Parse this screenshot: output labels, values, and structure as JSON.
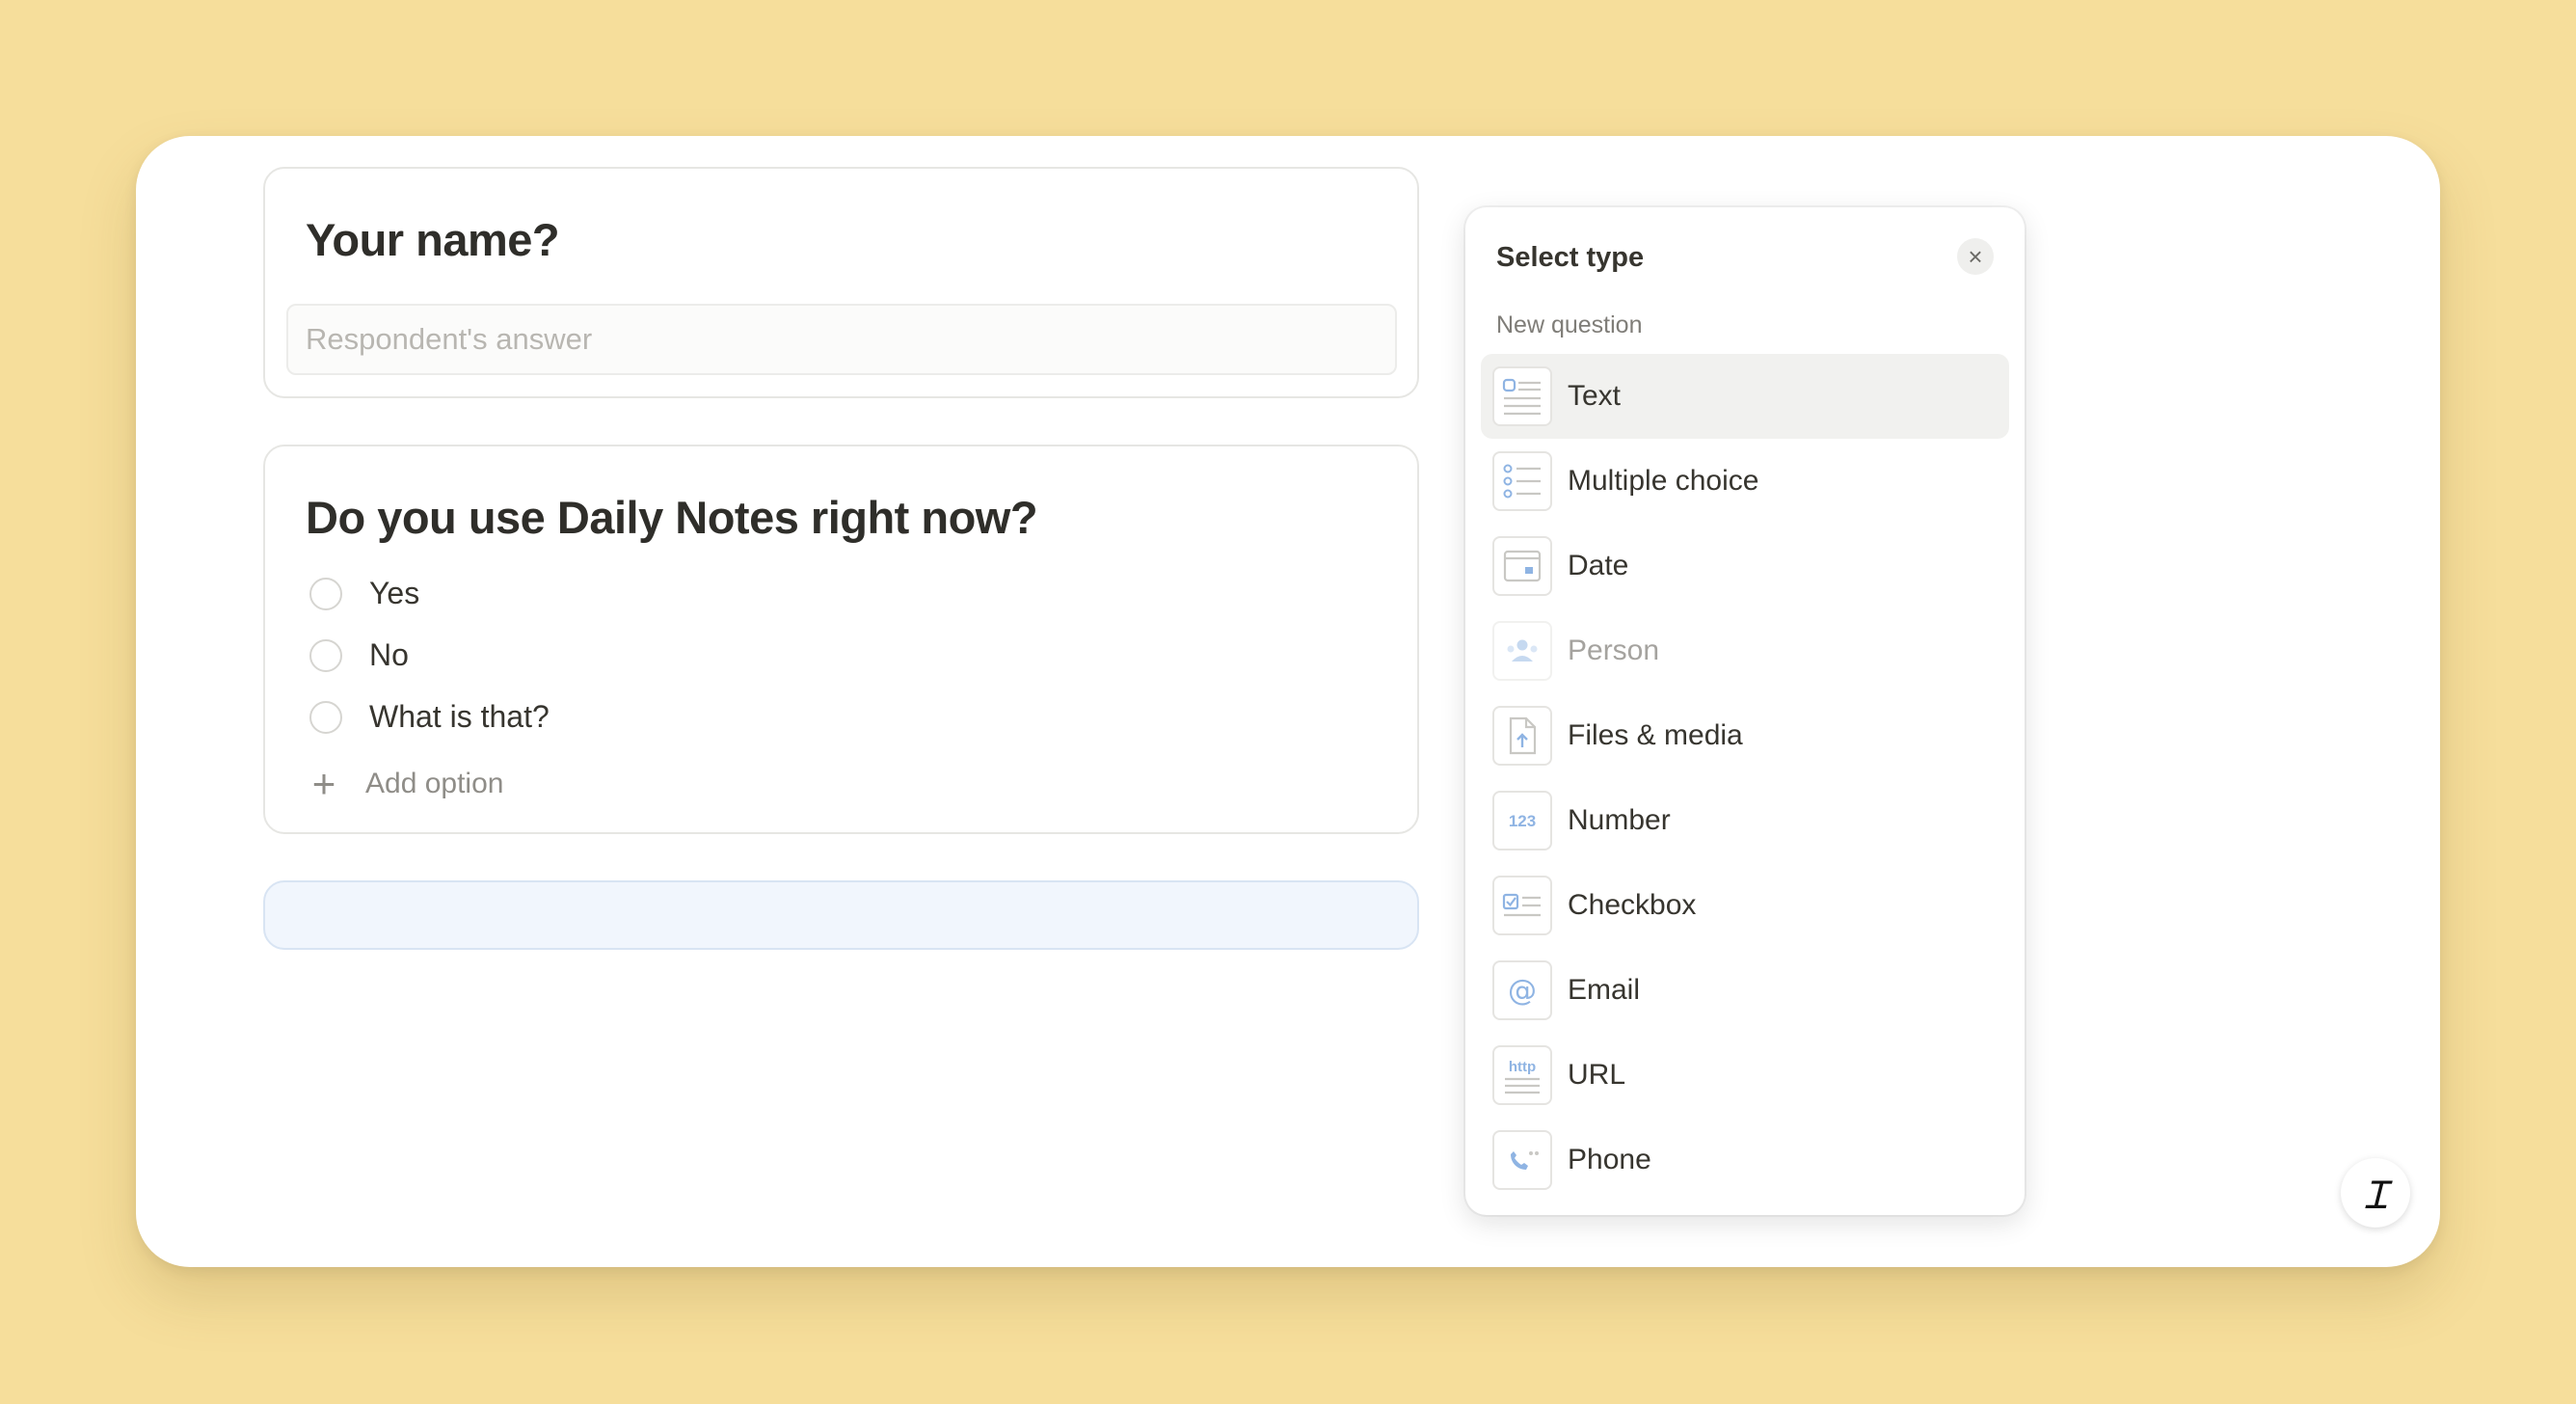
{
  "form": {
    "questions": [
      {
        "title": "Your name?",
        "answer_placeholder": "Respondent's answer"
      },
      {
        "title": "Do you use Daily Notes right now?",
        "options": [
          "Yes",
          "No",
          "What is that?"
        ],
        "add_option_label": "Add option"
      }
    ]
  },
  "type_panel": {
    "title": "Select type",
    "close_icon": "close-icon",
    "section_label": "New question",
    "items": [
      {
        "label": "Text",
        "icon": "text-type-icon",
        "active": true
      },
      {
        "label": "Multiple choice",
        "icon": "multiple-choice-icon"
      },
      {
        "label": "Date",
        "icon": "calendar-icon"
      },
      {
        "label": "Person",
        "icon": "person-icon",
        "disabled": true
      },
      {
        "label": "Files & media",
        "icon": "file-upload-icon"
      },
      {
        "label": "Number",
        "icon": "number-icon"
      },
      {
        "label": "Checkbox",
        "icon": "checkbox-icon"
      },
      {
        "label": "Email",
        "icon": "at-sign-icon"
      },
      {
        "label": "URL",
        "icon": "url-icon"
      },
      {
        "label": "Phone",
        "icon": "phone-icon"
      }
    ]
  },
  "colors": {
    "background": "#f6de9b",
    "icon_accent": "#8fb4e3",
    "active_row": "#f1f1ef"
  },
  "help_button": {
    "icon": "help-glyph-icon"
  }
}
